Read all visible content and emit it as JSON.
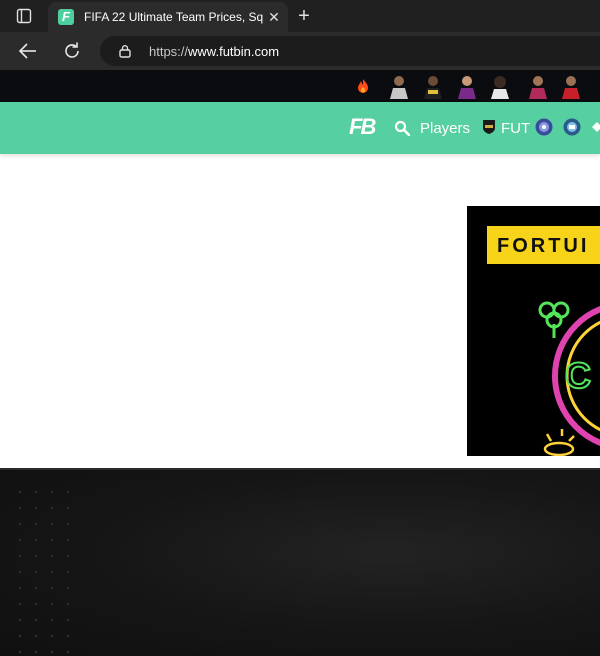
{
  "browser": {
    "tab_title": "FIFA 22 Ultimate Team Prices, Sq",
    "tab_favicon_letter": "F",
    "close_glyph": "✕",
    "newtab_glyph": "+",
    "url_scheme": "https://",
    "url_host": "www.futbin.com"
  },
  "site": {
    "logo_text": "FB",
    "nav": {
      "players_label": "Players",
      "fut_label": "FUT"
    },
    "ad": {
      "banner_text": "FORTUI"
    },
    "colors": {
      "nav_green": "#56cfa1",
      "top_strip": "#0b0c10",
      "ad_yellow": "#f7d41a"
    },
    "icons": [
      "fire-icon",
      "player-avatar",
      "search-icon",
      "fut-badge-icon",
      "round-club-icon",
      "partial-icon"
    ]
  }
}
